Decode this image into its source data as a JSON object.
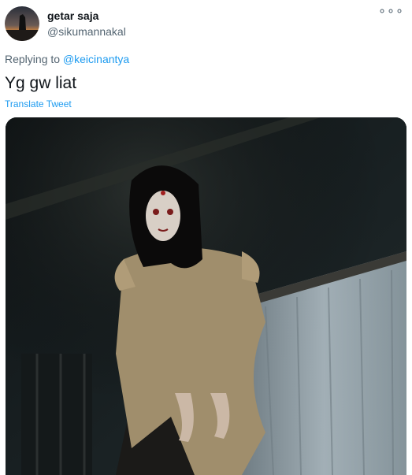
{
  "tweet": {
    "display_name": "getar saja",
    "handle": "@sikumannakal",
    "more_icon": "ellipsis-icon",
    "replying_to_prefix": "Replying to ",
    "replying_to_user": "@keicinantya",
    "text": "Yg gw liat",
    "translate_label": "Translate Tweet"
  },
  "media": {
    "description_icon": "photo-image"
  },
  "colors": {
    "link": "#1d9bf0",
    "secondary_text": "#536471",
    "primary_text": "#0f1419"
  }
}
